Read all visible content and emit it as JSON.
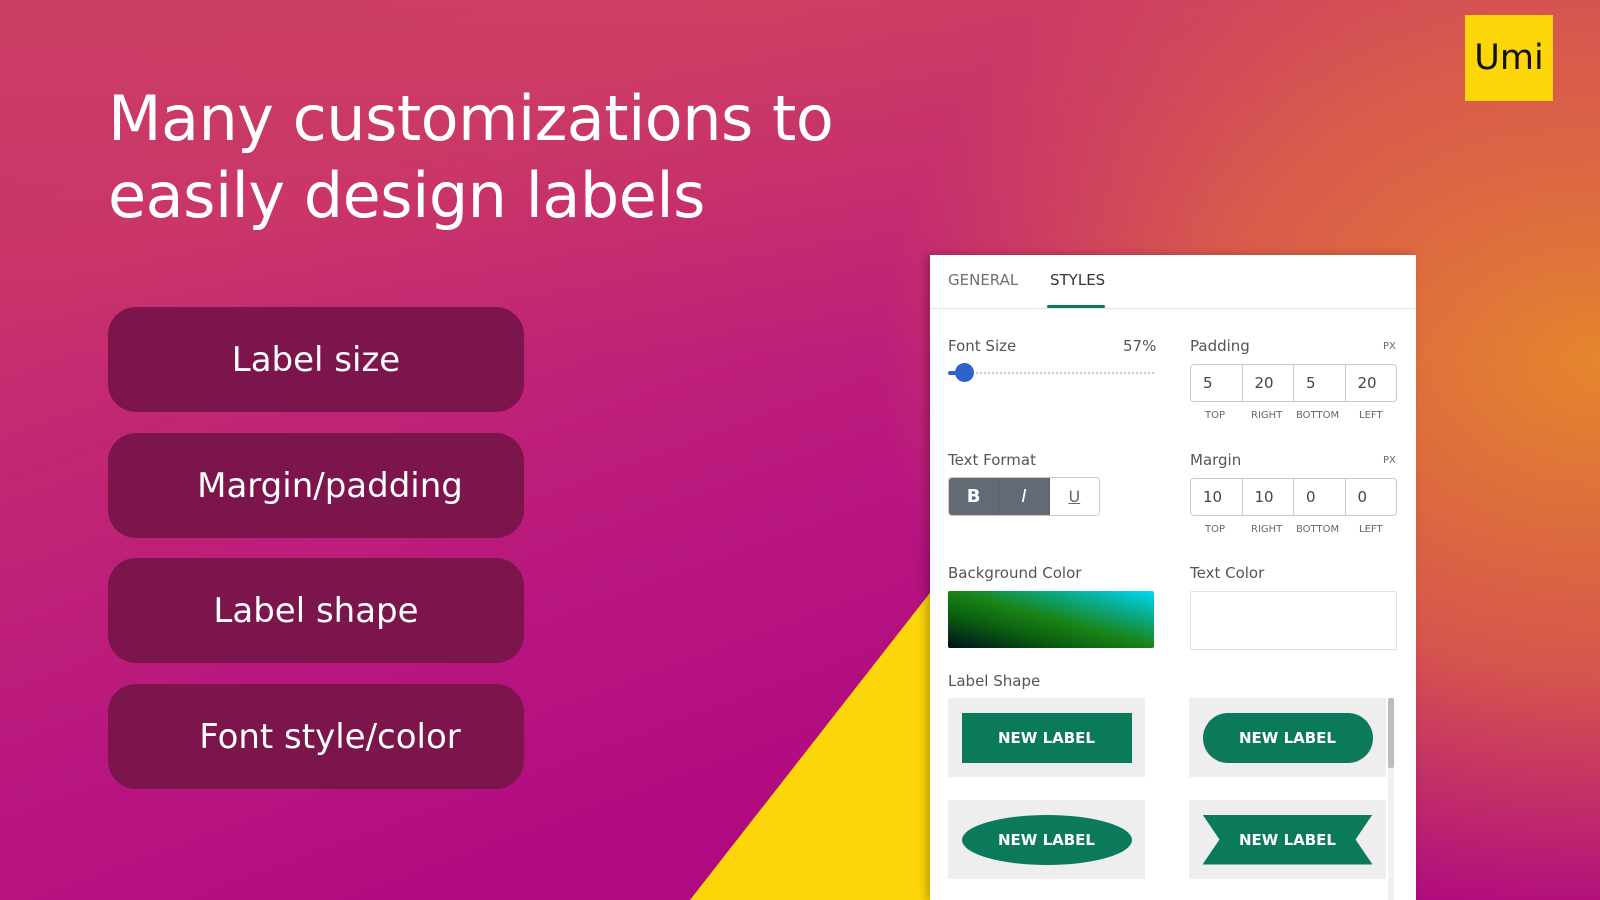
{
  "brand": {
    "logo_text": "Umi",
    "logo_color": "#fdd60a"
  },
  "headline": {
    "line1": "Many customizations to",
    "line2": "easily design labels"
  },
  "features": [
    {
      "label": "Label size"
    },
    {
      "label": "Margin/padding"
    },
    {
      "label": "Label shape"
    },
    {
      "label": "Font style/color"
    }
  ],
  "panel": {
    "tabs": [
      {
        "label": "GENERAL",
        "active": false
      },
      {
        "label": "STYLES",
        "active": true
      }
    ],
    "font_size": {
      "label": "Font Size",
      "value": "57%",
      "fraction": 0.08
    },
    "padding": {
      "label": "Padding",
      "unit": "PX",
      "values": [
        {
          "side": "TOP",
          "value": "5"
        },
        {
          "side": "RIGHT",
          "value": "20"
        },
        {
          "side": "BOTTOM",
          "value": "5"
        },
        {
          "side": "LEFT",
          "value": "20"
        }
      ]
    },
    "margin": {
      "label": "Margin",
      "unit": "PX",
      "values": [
        {
          "side": "TOP",
          "value": "10"
        },
        {
          "side": "RIGHT",
          "value": "10"
        },
        {
          "side": "BOTTOM",
          "value": "0"
        },
        {
          "side": "LEFT",
          "value": "0"
        }
      ]
    },
    "text_format": {
      "label": "Text Format",
      "bold": "B",
      "italic": "I",
      "underline": "U",
      "bold_on": true,
      "italic_on": true,
      "underline_on": false
    },
    "background_color": {
      "label": "Background Color"
    },
    "text_color": {
      "label": "Text Color",
      "value": "#ffffff"
    },
    "label_shape": {
      "label": "Label Shape",
      "shapes": [
        {
          "name": "rectangle",
          "text": "NEW LABEL"
        },
        {
          "name": "rounded",
          "text": "NEW LABEL"
        },
        {
          "name": "ellipse",
          "text": "NEW LABEL"
        },
        {
          "name": "ribbon",
          "text": "NEW LABEL"
        }
      ],
      "shape_color": "#0b7a5a"
    }
  }
}
